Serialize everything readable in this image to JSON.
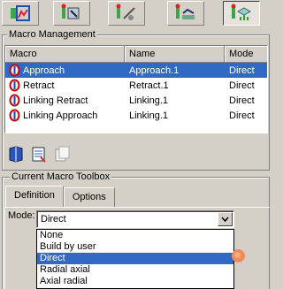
{
  "macro_management": {
    "title": "Macro Management",
    "columns": [
      "Macro",
      "Name",
      "Mode"
    ],
    "rows": [
      {
        "macro": "Approach",
        "name": "Approach.1",
        "mode": "Direct",
        "selected": true
      },
      {
        "macro": "Retract",
        "name": "Retract.1",
        "mode": "Direct",
        "selected": false
      },
      {
        "macro": "Linking Retract",
        "name": "Linking.1",
        "mode": "Direct",
        "selected": false
      },
      {
        "macro": "Linking Approach",
        "name": "Linking.1",
        "mode": "Direct",
        "selected": false
      }
    ]
  },
  "toolbox": {
    "title": "Current Macro Toolbox",
    "tabs": [
      "Definition",
      "Options"
    ],
    "active_tab": "Definition",
    "mode_label": "Mode:",
    "mode_value": "Direct",
    "mode_options": [
      "None",
      "Build by user",
      "Direct",
      "Radial axial",
      "Axial radial"
    ]
  },
  "top_tabs": [
    "geometry-tab-icon",
    "tool-tab-icon",
    "feeds-speeds-tab-icon",
    "strategy-tab-icon",
    "macros-tab-icon"
  ],
  "colors": {
    "selection": "#316ac5",
    "panel": "#d4d0c8",
    "indicator": "#f08c5c"
  }
}
